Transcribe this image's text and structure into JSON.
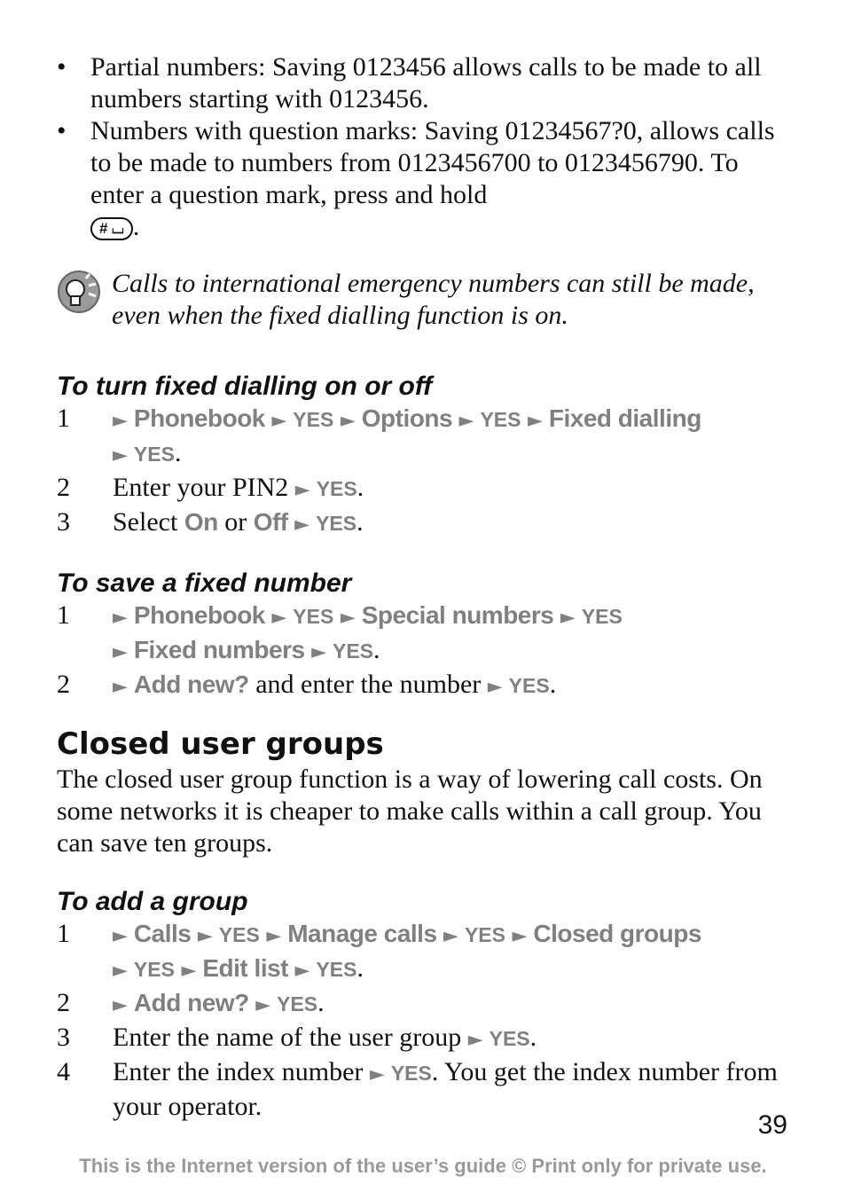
{
  "bullets": [
    {
      "text": "Partial numbers: Saving 0123456 allows calls to be made to all numbers starting with 0123456."
    },
    {
      "text": "Numbers with question marks: Saving 01234567?0, allows calls to be made to numbers from 0123456700 to 0123456790. To enter a question mark, press and hold",
      "key": "# ⌴",
      "end": "."
    }
  ],
  "tip": {
    "icon": "lightbulb-tip-icon",
    "text": "Calls to international emergency numbers can still be made, even when the fixed dialling function is on."
  },
  "section1": {
    "title": "To turn fixed dialling on or off",
    "steps": [
      {
        "num": "1",
        "path": [
          "Phonebook",
          "YES",
          "Options",
          "YES",
          "Fixed dialling",
          "YES"
        ]
      },
      {
        "num": "2",
        "pre": "Enter your PIN2",
        "path": [
          "YES"
        ]
      },
      {
        "num": "3",
        "pre": "Select",
        "on": "On",
        "or": "or",
        "off": "Off",
        "path": [
          "YES"
        ]
      }
    ]
  },
  "section2": {
    "title": "To save a fixed number",
    "steps": [
      {
        "num": "1",
        "path": [
          "Phonebook",
          "YES",
          "Special numbers",
          "YES",
          "Fixed numbers",
          "YES"
        ]
      },
      {
        "num": "2",
        "item": "Add new?",
        "mid": "and enter the number",
        "path": [
          "YES"
        ]
      }
    ]
  },
  "heading": "Closed user groups",
  "paragraph": "The closed user group function is a way of lowering call costs. On some networks it is cheaper to make calls within a call group. You can save ten groups.",
  "section3": {
    "title": "To add a group",
    "steps": [
      {
        "num": "1",
        "path": [
          "Calls",
          "YES",
          "Manage calls",
          "YES",
          "Closed groups",
          "YES",
          "Edit list",
          "YES"
        ]
      },
      {
        "num": "2",
        "path": [
          "Add new?",
          "YES"
        ]
      },
      {
        "num": "3",
        "pre": "Enter the name of the user group",
        "path": [
          "YES"
        ]
      },
      {
        "num": "4",
        "pre": "Enter the index number",
        "path": [
          "YES"
        ],
        "post": ". You get the index number from your operator."
      }
    ]
  },
  "page_number": "39",
  "footer": "This is the Internet version of the user’s guide © Print only for private use.",
  "arrow": "►"
}
